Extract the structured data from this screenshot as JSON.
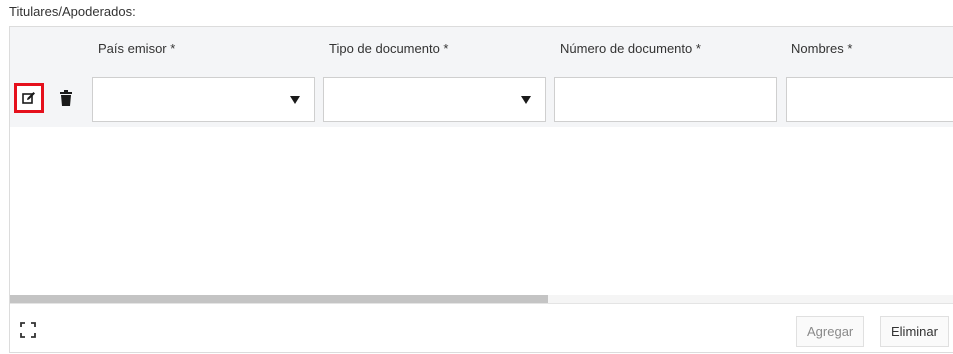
{
  "section": {
    "title": "Titulares/Apoderados:"
  },
  "grid": {
    "columns": [
      {
        "label": "País emisor *"
      },
      {
        "label": "Tipo de documento *"
      },
      {
        "label": "Número de documento *"
      },
      {
        "label": "Nombres *"
      }
    ],
    "edit_row": {
      "pais_emisor": "",
      "tipo_documento": "",
      "numero_documento": "",
      "nombres": ""
    },
    "row_actions": {
      "edit_icon": "edit-icon",
      "delete_icon": "trash-icon"
    },
    "horizontal_scroll_fraction": 0.57
  },
  "footer": {
    "expand_icon": "fullscreen-icon",
    "add_label": "Agregar",
    "remove_label": "Eliminar"
  },
  "colors": {
    "edit_highlight": "#e5101c",
    "header_bg": "#f4f5f7",
    "border": "#dcdcdc"
  }
}
